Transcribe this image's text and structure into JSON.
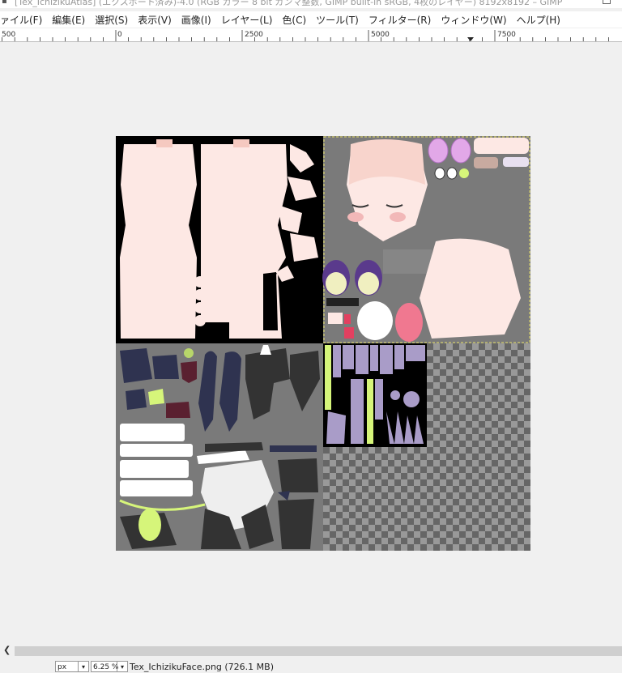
{
  "window": {
    "title": "[Tex_IchizikuAtlas] (エクスポート済み)-4.0 (RGB カラー 8 bit ガンマ整数, GIMP built-in sRGB, 4枚のレイヤー) 8192x8192 – GIMP"
  },
  "menu": {
    "items": [
      "ァイル(F)",
      "編集(E)",
      "選択(S)",
      "表示(V)",
      "画像(I)",
      "レイヤー(L)",
      "色(C)",
      "ツール(T)",
      "フィルター(R)",
      "ウィンドウ(W)",
      "ヘルプ(H)"
    ]
  },
  "ruler": {
    "labels": [
      "500",
      "0",
      "2500",
      "5000",
      "7500"
    ]
  },
  "statusbar": {
    "unit": "px",
    "zoom": "6.25 %",
    "info": "Tex_IchizikuFace.png (726.1 MB)"
  },
  "colors": {
    "canvas_bg": "#f0f0f0",
    "texture_gray": "#7a7a7a",
    "skin": "#fde8e4",
    "navy": "#2f3350",
    "lavender": "#a99cc8",
    "lime": "#d6f57a",
    "pink": "#f2a2b8",
    "purple_eye": "#5a3a8c"
  }
}
